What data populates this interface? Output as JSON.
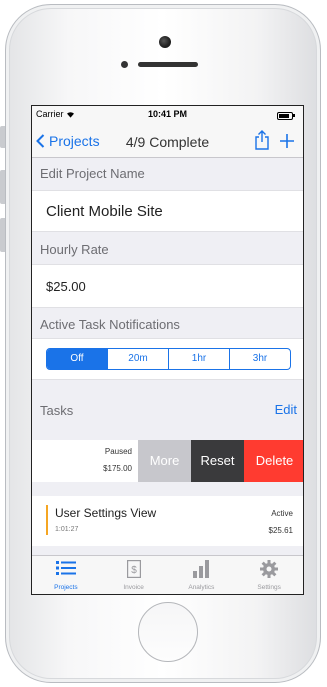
{
  "status_bar": {
    "carrier": "Carrier",
    "time": "10:41 PM"
  },
  "nav": {
    "back_label": "Projects",
    "title": "4/9 Complete"
  },
  "form": {
    "project_name_label": "Edit Project Name",
    "project_name_value": "Client Mobile Site",
    "hourly_rate_label": "Hourly Rate",
    "hourly_rate_value": "$25.00",
    "notifications_label": "Active Task Notifications",
    "notification_options": [
      "Off",
      "20m",
      "1hr",
      "3hr"
    ],
    "notification_selected": "Off"
  },
  "tasks": {
    "header_label": "Tasks",
    "edit_label": "Edit",
    "swiped_row": {
      "status": "Paused",
      "amount": "$175.00",
      "actions": {
        "more": "More",
        "reset": "Reset",
        "delete": "Delete"
      }
    },
    "items": [
      {
        "name": "User Settings View",
        "duration": "1:01:27",
        "status": "Active",
        "amount": "$25.61"
      }
    ]
  },
  "tabbar": {
    "tabs": [
      {
        "label": "Projects",
        "icon": "list-icon",
        "active": true
      },
      {
        "label": "Invoice",
        "icon": "invoice-icon",
        "active": false
      },
      {
        "label": "Analytics",
        "icon": "bar-chart-icon",
        "active": false
      },
      {
        "label": "Settings",
        "icon": "gear-icon",
        "active": false
      }
    ]
  },
  "colors": {
    "accent": "#1a73e8",
    "delete": "#ff3b30",
    "reset": "#3a3a3c",
    "more": "#c7c7cc",
    "task_indicator": "#f5a623",
    "background": "#efeff4"
  }
}
